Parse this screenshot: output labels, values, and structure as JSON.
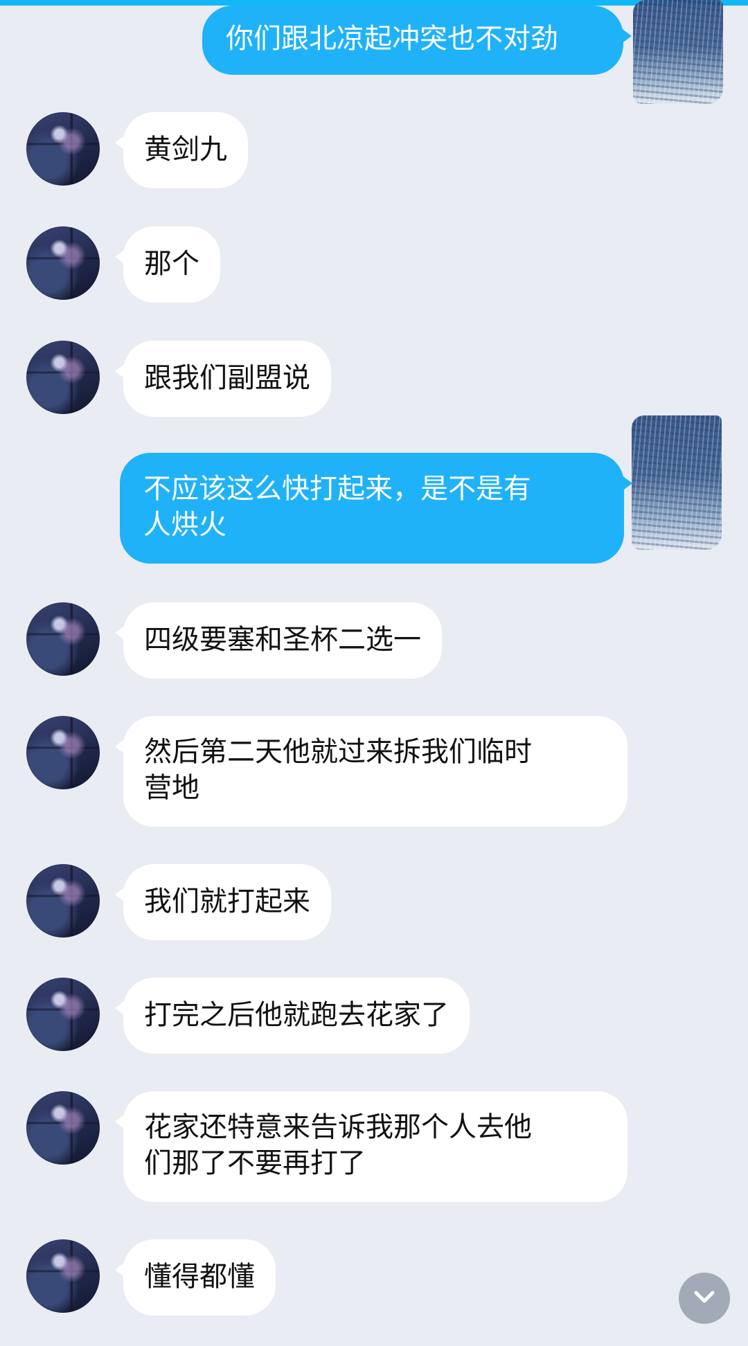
{
  "messages": [
    {
      "side": "out",
      "text": "你们跟北凉起冲突也不对劲"
    },
    {
      "side": "in",
      "text": "黄剑九"
    },
    {
      "side": "in",
      "text": "那个"
    },
    {
      "side": "in",
      "text": "跟我们副盟说"
    },
    {
      "side": "out",
      "text": "不应该这么快打起来，是不是有\n人烘火"
    },
    {
      "side": "in",
      "text": "四级要塞和圣杯二选一"
    },
    {
      "side": "in",
      "text": "然后第二天他就过来拆我们临时\n营地"
    },
    {
      "side": "in",
      "text": "我们就打起来"
    },
    {
      "side": "in",
      "text": "打完之后他就跑去花家了"
    },
    {
      "side": "in",
      "text": "花家还特意来告诉我那个人去他\n们那了不要再打了"
    },
    {
      "side": "in",
      "text": "懂得都懂"
    }
  ],
  "icons": {
    "scroll_down": "chevron-down-icon"
  },
  "colors": {
    "background": "#e9ecf3",
    "outgoing_bubble": "#1fb2f8",
    "incoming_bubble": "#ffffff",
    "scroll_button": "#a2a9b7"
  }
}
